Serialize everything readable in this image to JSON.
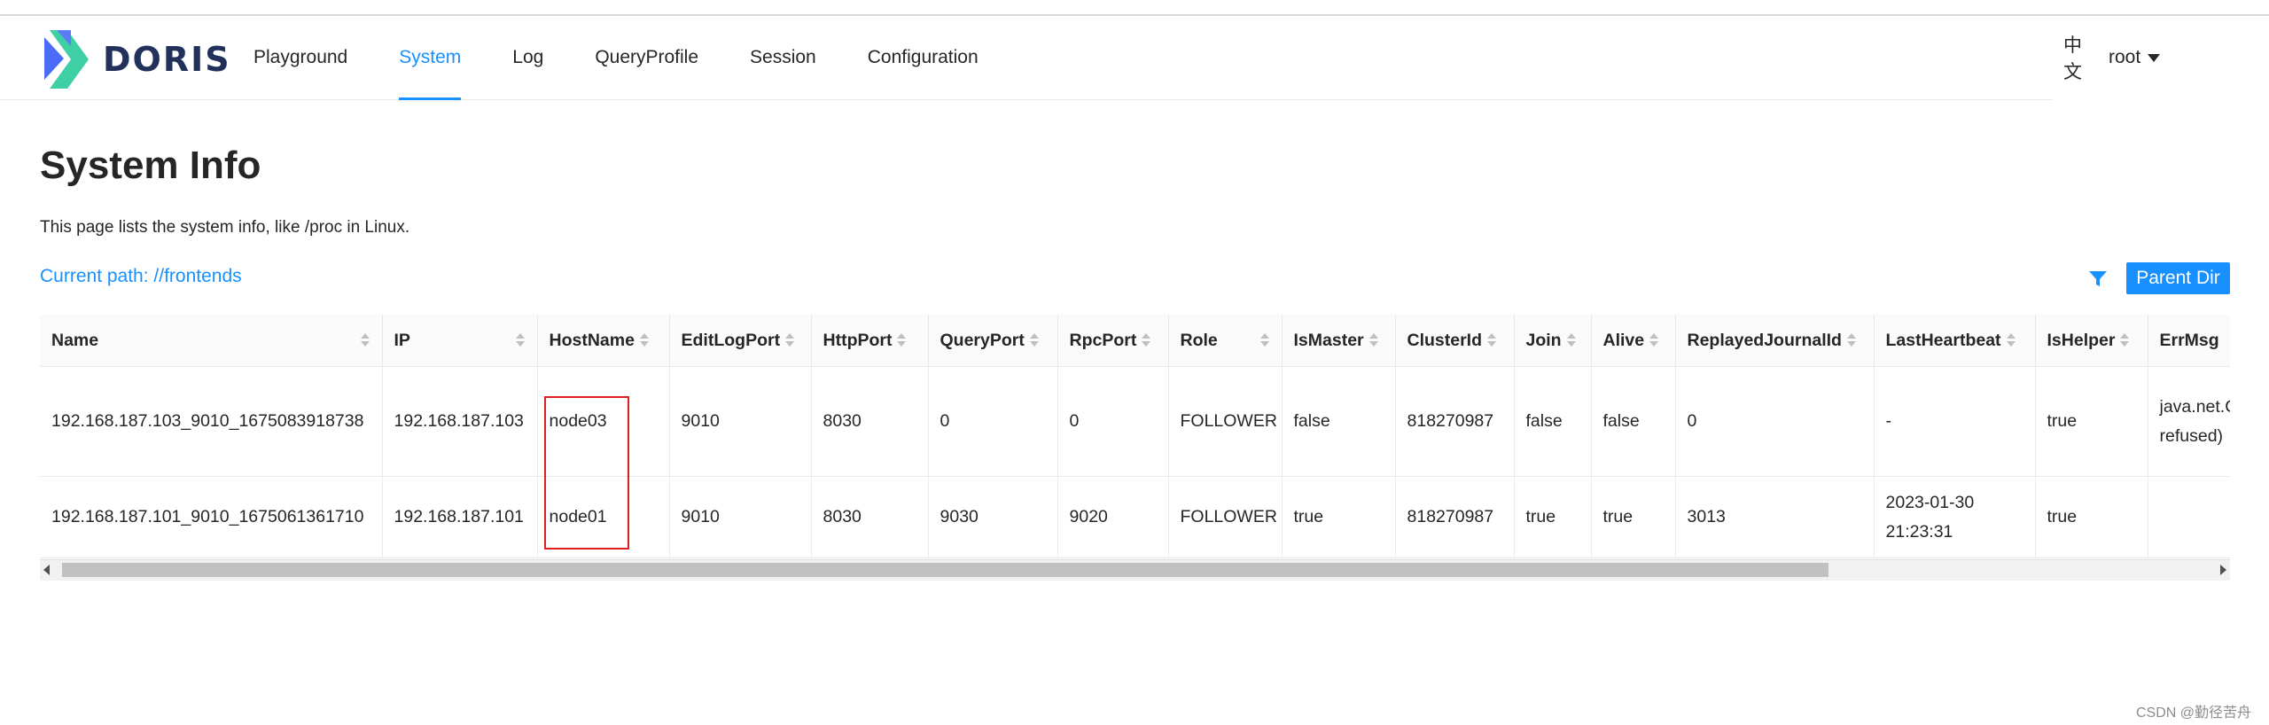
{
  "app": {
    "logo_text": "DORIS"
  },
  "nav": {
    "items": [
      {
        "label": "Playground"
      },
      {
        "label": "System"
      },
      {
        "label": "Log"
      },
      {
        "label": "QueryProfile"
      },
      {
        "label": "Session"
      },
      {
        "label": "Configuration"
      }
    ],
    "active": "System"
  },
  "header": {
    "language": "中文",
    "user": "root"
  },
  "page": {
    "title": "System Info",
    "description": "This page lists the system info, like /proc in Linux.",
    "current_path": "Current path: //frontends",
    "parent_dir_label": "Parent Dir"
  },
  "table": {
    "columns": [
      "Name",
      "IP",
      "HostName",
      "EditLogPort",
      "HttpPort",
      "QueryPort",
      "RpcPort",
      "Role",
      "IsMaster",
      "ClusterId",
      "Join",
      "Alive",
      "ReplayedJournalId",
      "LastHeartbeat",
      "IsHelper",
      "ErrMsg"
    ],
    "rows": [
      {
        "name": "192.168.187.103_9010_1675083918738",
        "ip": "192.168.187.103",
        "hostname": "node03",
        "edit_log_port": "9010",
        "http_port": "8030",
        "query_port": "0",
        "rpc_port": "0",
        "role": "FOLLOWER",
        "is_master": "false",
        "cluster_id": "818270987",
        "join": "false",
        "alive": "false",
        "replayed_journal_id": "0",
        "last_heartbeat": "-",
        "is_helper": "true",
        "err_msg": "java.net.C 拒绝连接 refused)"
      },
      {
        "name": "192.168.187.101_9010_1675061361710",
        "ip": "192.168.187.101",
        "hostname": "node01",
        "edit_log_port": "9010",
        "http_port": "8030",
        "query_port": "9030",
        "rpc_port": "9020",
        "role": "FOLLOWER",
        "is_master": "true",
        "cluster_id": "818270987",
        "join": "true",
        "alive": "true",
        "replayed_journal_id": "3013",
        "last_heartbeat": "2023-01-30 21:23:31",
        "is_helper": "true",
        "err_msg": ""
      }
    ]
  },
  "watermark": "CSDN @勤径苦舟",
  "colors": {
    "accent": "#1890ff",
    "highlight_box": "#e02020",
    "logo_blue": "#4a6cf7",
    "logo_green": "#3ecfa4"
  },
  "icons": [
    "doris-logo",
    "filter-icon",
    "sort-icon",
    "caret-down-icon",
    "scroll-left-icon",
    "scroll-right-icon"
  ]
}
